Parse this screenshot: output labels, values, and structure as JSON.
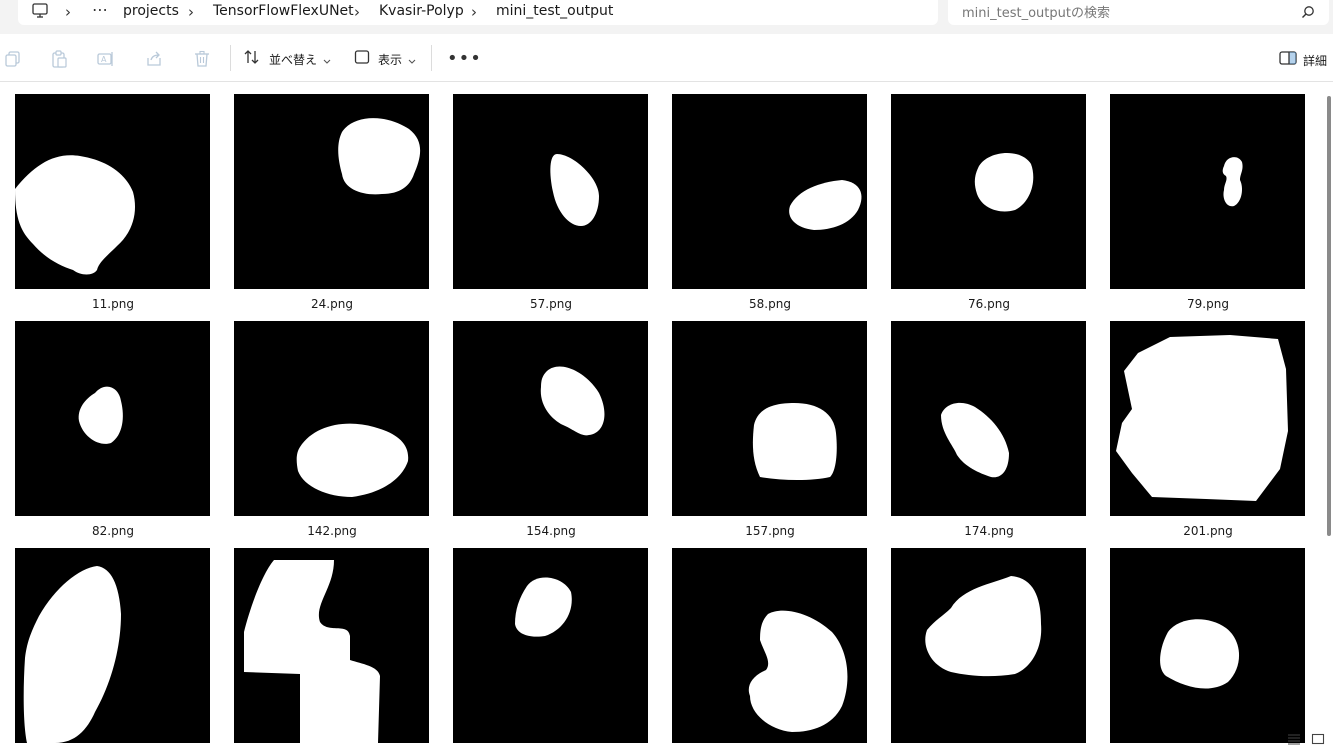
{
  "breadcrumb": {
    "more": "⋯",
    "items": [
      "projects",
      "TensorFlowFlexUNet",
      "Kvasir-Polyp",
      "mini_test_output"
    ]
  },
  "search": {
    "placeholder": "mini_test_outputの検索"
  },
  "toolbar": {
    "sort_label": "並べ替え",
    "view_label": "表示",
    "more": "•••",
    "details_label": "詳細"
  },
  "files": [
    {
      "name": "11.png"
    },
    {
      "name": "24.png"
    },
    {
      "name": "57.png"
    },
    {
      "name": "58.png"
    },
    {
      "name": "76.png"
    },
    {
      "name": "79.png"
    },
    {
      "name": "82.png"
    },
    {
      "name": "142.png"
    },
    {
      "name": "154.png"
    },
    {
      "name": "157.png"
    },
    {
      "name": "174.png"
    },
    {
      "name": "201.png"
    },
    {
      "name": ""
    },
    {
      "name": ""
    },
    {
      "name": ""
    },
    {
      "name": ""
    },
    {
      "name": ""
    },
    {
      "name": ""
    }
  ],
  "colors": {
    "thumbnail_bg": "#000000",
    "mask": "#ffffff"
  }
}
